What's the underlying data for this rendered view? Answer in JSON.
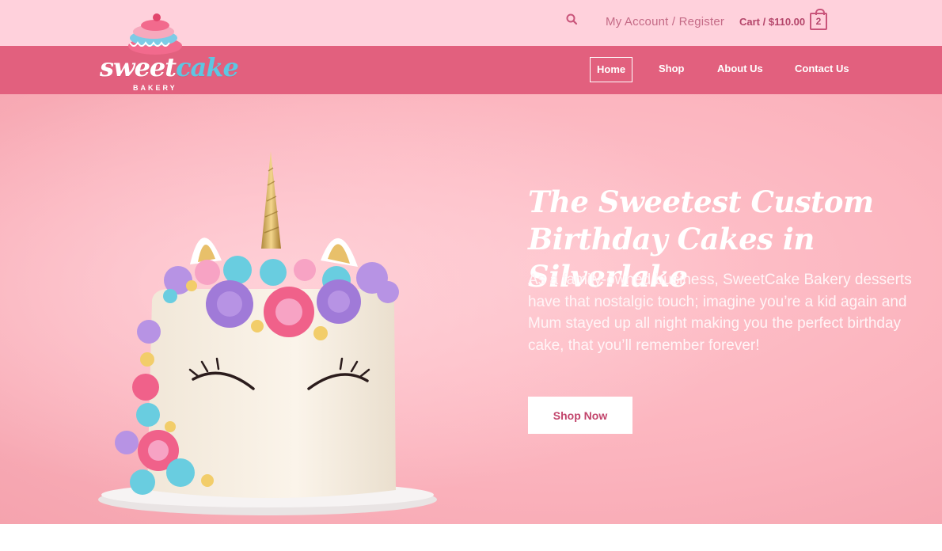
{
  "brand": {
    "name_part1": "sweet",
    "name_part2": "cake",
    "tagline": "BAKERY"
  },
  "topbar": {
    "account_label": "My Account / Register",
    "cart_label": "Cart / $110.00",
    "cart_count": "2"
  },
  "nav": {
    "items": [
      {
        "label": "Home",
        "active": true
      },
      {
        "label": "Shop",
        "active": false
      },
      {
        "label": "About Us",
        "active": false
      },
      {
        "label": "Contact Us",
        "active": false
      }
    ]
  },
  "hero": {
    "title": "The Sweetest Custom Birthday Cakes in Silverlake",
    "body": "As a family-owned business, SweetCake Bakery desserts have that nostalgic touch; imagine you’re a kid again and Mum stayed up all night making you the perfect birthday cake, that you’ll remember forever!",
    "cta_label": "Shop Now"
  },
  "icons": {
    "search": "search-icon",
    "logo": "cake-logo-icon",
    "hero_image": "unicorn-cake-image"
  },
  "colors": {
    "topbar_bg": "#ffd1dc",
    "nav_bg": "#e2607e",
    "hero_bg": "#fbb3bd",
    "accent": "#c2456c",
    "logo_cake": "#5ec6e2"
  }
}
